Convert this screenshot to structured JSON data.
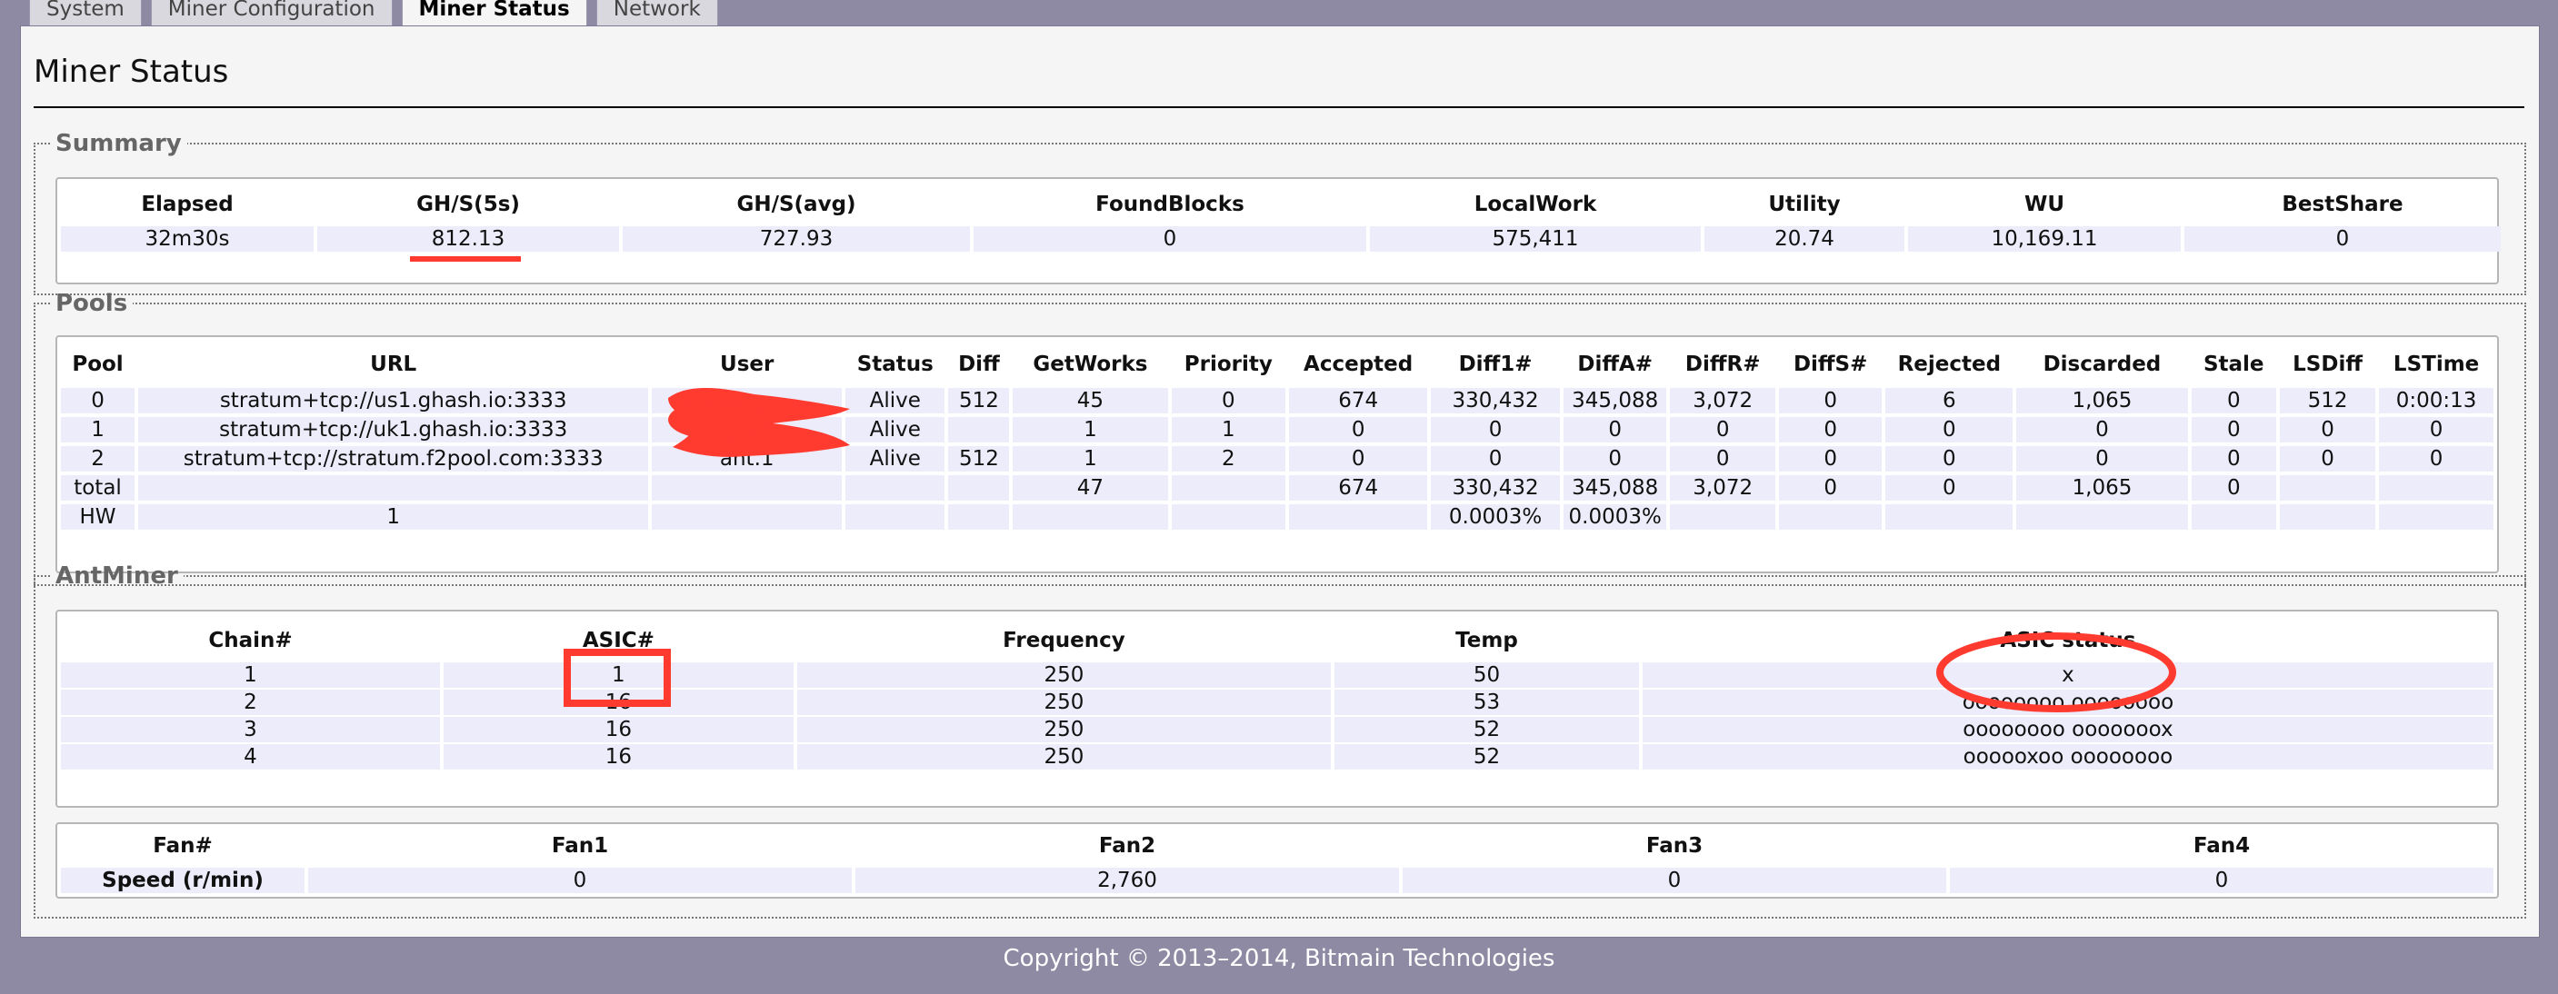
{
  "tabs": [
    "System",
    "Miner Configuration",
    "Miner Status",
    "Network"
  ],
  "page_title": "Miner Status",
  "summary": {
    "legend": "Summary",
    "headers": [
      "Elapsed",
      "GH/S(5s)",
      "GH/S(avg)",
      "FoundBlocks",
      "LocalWork",
      "Utility",
      "WU",
      "BestShare"
    ],
    "row": [
      "32m30s",
      "812.13",
      "727.93",
      "0",
      "575,411",
      "20.74",
      "10,169.11",
      "0"
    ]
  },
  "pools": {
    "legend": "Pools",
    "headers": [
      "Pool",
      "URL",
      "User",
      "Status",
      "Diff",
      "GetWorks",
      "Priority",
      "Accepted",
      "Diff1#",
      "DiffA#",
      "DiffR#",
      "DiffS#",
      "Rejected",
      "Discarded",
      "Stale",
      "LSDiff",
      "LSTime"
    ],
    "rows": [
      [
        "0",
        "stratum+tcp://us1.ghash.io:3333",
        "",
        "Alive",
        "512",
        "45",
        "0",
        "674",
        "330,432",
        "345,088",
        "3,072",
        "0",
        "6",
        "1,065",
        "0",
        "512",
        "0:00:13"
      ],
      [
        "1",
        "stratum+tcp://uk1.ghash.io:3333",
        "",
        "Alive",
        "",
        "1",
        "1",
        "0",
        "0",
        "0",
        "0",
        "0",
        "0",
        "0",
        "0",
        "0",
        "0"
      ],
      [
        "2",
        "stratum+tcp://stratum.f2pool.com:3333",
        "ant.1",
        "Alive",
        "512",
        "1",
        "2",
        "0",
        "0",
        "0",
        "0",
        "0",
        "0",
        "0",
        "0",
        "0",
        "0"
      ],
      [
        "total",
        "",
        "",
        "",
        "",
        "47",
        "",
        "674",
        "330,432",
        "345,088",
        "3,072",
        "0",
        "0",
        "1,065",
        "0",
        "",
        ""
      ],
      [
        "HW",
        "1",
        "",
        "",
        "",
        "",
        "",
        "",
        "0.0003%",
        "0.0003%",
        "",
        "",
        "",
        "",
        "",
        "",
        ""
      ]
    ]
  },
  "antminer": {
    "legend": "AntMiner",
    "headers": [
      "Chain#",
      "ASIC#",
      "Frequency",
      "Temp",
      "ASIC status"
    ],
    "rows": [
      [
        "1",
        "1",
        "250",
        "50",
        "x"
      ],
      [
        "2",
        "16",
        "250",
        "53",
        "oooooooo oooooooo"
      ],
      [
        "3",
        "16",
        "250",
        "52",
        "oooooooo ooooooox"
      ],
      [
        "4",
        "16",
        "250",
        "52",
        "oooooxoo oooooooo"
      ]
    ]
  },
  "fans": {
    "headers": [
      "Fan#",
      "Fan1",
      "Fan2",
      "Fan3",
      "Fan4"
    ],
    "row": [
      "Speed (r/min)",
      "0",
      "2,760",
      "0",
      "0"
    ]
  },
  "footer": "Copyright © 2013–2014, Bitmain Technologies",
  "colors": {
    "background": "#8e8aa3",
    "panel": "#f5f5f5",
    "row_bg": "#ececfb",
    "annotation_red": "#ff3b30"
  }
}
